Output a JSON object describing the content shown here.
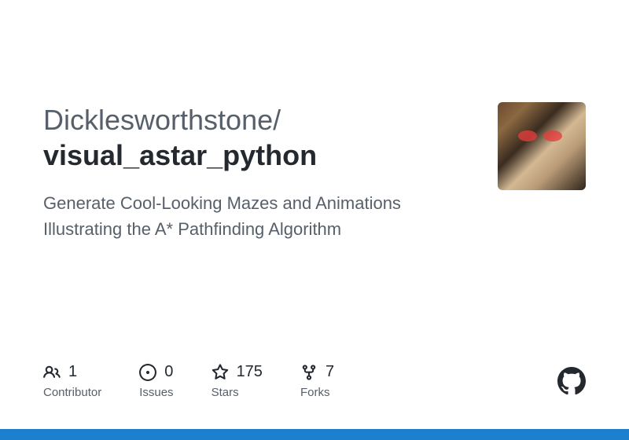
{
  "repo": {
    "owner": "Dicklesworthstone",
    "slash": "/",
    "name": "visual_astar_python",
    "description": "Generate Cool-Looking Mazes and Animations Illustrating the A* Pathfinding Algorithm"
  },
  "stats": {
    "contributors": {
      "count": "1",
      "label": "Contributor"
    },
    "issues": {
      "count": "0",
      "label": "Issues"
    },
    "stars": {
      "count": "175",
      "label": "Stars"
    },
    "forks": {
      "count": "7",
      "label": "Forks"
    }
  },
  "colors": {
    "accent_bar": "#1d80ce",
    "text_primary": "#24292f",
    "text_muted": "#57606a"
  }
}
